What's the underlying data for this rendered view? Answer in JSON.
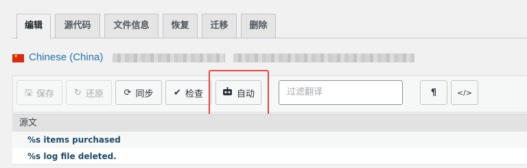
{
  "tabs": [
    {
      "label": "编辑",
      "active": true
    },
    {
      "label": "源代码",
      "active": false
    },
    {
      "label": "文件信息",
      "active": false
    },
    {
      "label": "恢复",
      "active": false
    },
    {
      "label": "迁移",
      "active": false
    },
    {
      "label": "删除",
      "active": false
    }
  ],
  "language": {
    "name": "Chinese (China)",
    "flag_icon": "china-flag-icon"
  },
  "toolbar": {
    "save_label": "保存",
    "revert_label": "还原",
    "sync_label": "同步",
    "check_label": "检查",
    "auto_label": "自动",
    "filter_placeholder": "过滤翻译",
    "pilcrow_glyph": "¶",
    "code_glyph": "</>"
  },
  "table": {
    "header": "源文",
    "rows": [
      "%s items purchased",
      "%s log file deleted."
    ]
  },
  "colors": {
    "accent": "#2271b1",
    "highlight": "#e8463c"
  }
}
